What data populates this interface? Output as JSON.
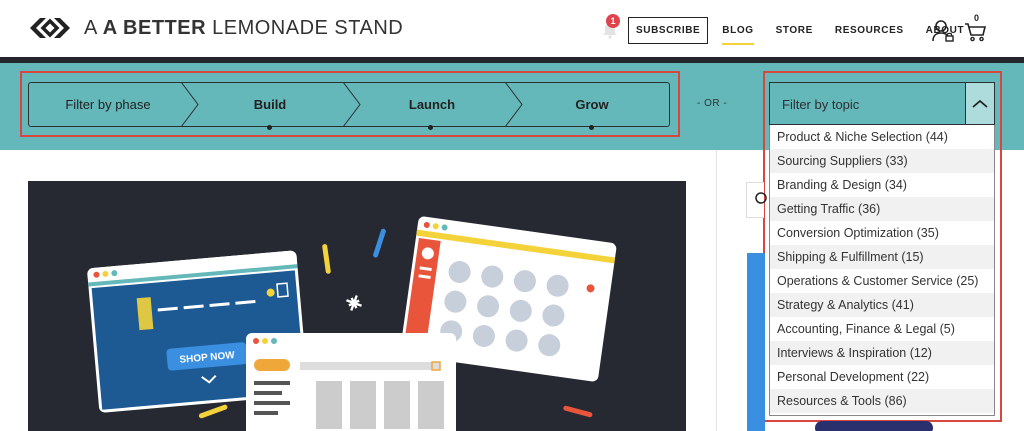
{
  "header": {
    "logo_bold": "A BETTER",
    "logo_light": "LEMONADE STAND",
    "notification_count": "1",
    "nav": [
      {
        "label": "SUBSCRIBE"
      },
      {
        "label": "BLOG"
      },
      {
        "label": "STORE"
      },
      {
        "label": "RESOURCES"
      },
      {
        "label": "ABOUT"
      }
    ],
    "cart_count": "0"
  },
  "filters": {
    "phase_placeholder": "Filter by phase",
    "phases": [
      "Build",
      "Launch",
      "Grow"
    ],
    "or_label": "- OR -",
    "topic_placeholder": "Filter by topic",
    "topics": [
      "Product & Niche Selection (44)",
      "Sourcing Suppliers (33)",
      "Branding & Design (34)",
      "Getting Traffic (36)",
      "Conversion Optimization (35)",
      "Shipping & Fulfillment (15)",
      "Operations & Customer Service (25)",
      "Strategy & Analytics (41)",
      "Accounting, Finance & Legal (5)",
      "Interviews & Inspiration (12)",
      "Personal Development (22)",
      "Resources & Tools (86)"
    ]
  },
  "hero": {
    "button_label": "SHOP NOW"
  },
  "colors": {
    "teal": "#64b8b9",
    "highlight_red": "#d9453f",
    "hero_bg": "#262932",
    "accent_yellow": "#f4d33a"
  }
}
